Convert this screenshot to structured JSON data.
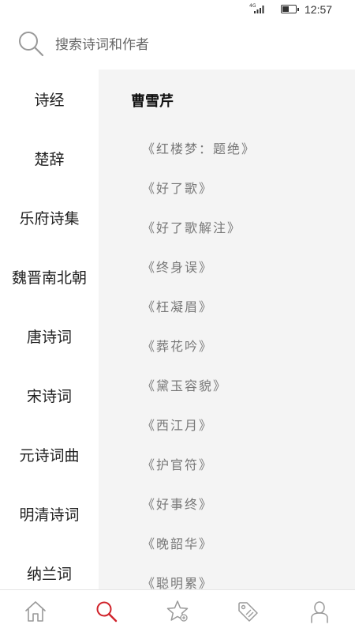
{
  "status_bar": {
    "network": "4G",
    "time": "12:57",
    "battery_level": 0.55,
    "icons": [
      "signal-icon",
      "battery-icon"
    ]
  },
  "search": {
    "placeholder": "搜索诗词和作者",
    "value": "",
    "icon": "search-icon"
  },
  "sidebar": {
    "items": [
      {
        "label": "诗经"
      },
      {
        "label": "楚辞"
      },
      {
        "label": "乐府诗集"
      },
      {
        "label": "魏晋南北朝"
      },
      {
        "label": "唐诗词"
      },
      {
        "label": "宋诗词"
      },
      {
        "label": "元诗词曲"
      },
      {
        "label": "明清诗词"
      },
      {
        "label": "纳兰词"
      }
    ]
  },
  "content": {
    "author": "曹雪芹",
    "poems": [
      {
        "title": "《红楼梦：题绝》"
      },
      {
        "title": "《好了歌》"
      },
      {
        "title": "《好了歌解注》"
      },
      {
        "title": "《终身误》"
      },
      {
        "title": "《枉凝眉》"
      },
      {
        "title": "《葬花吟》"
      },
      {
        "title": "《黛玉容貌》"
      },
      {
        "title": "《西江月》"
      },
      {
        "title": "《护官符》"
      },
      {
        "title": "《好事终》"
      },
      {
        "title": "《晚韶华》"
      },
      {
        "title": "《聪明累》"
      }
    ]
  },
  "bottom_nav": {
    "items": [
      {
        "icon": "home-icon",
        "active": false
      },
      {
        "icon": "search-icon",
        "active": true
      },
      {
        "icon": "star-icon",
        "active": false
      },
      {
        "icon": "tag-icon",
        "active": false
      },
      {
        "icon": "user-icon",
        "active": false
      }
    ],
    "active_color": "#d0222a",
    "inactive_color": "#999999"
  },
  "colors": {
    "content_background": "#f4f4f4",
    "poem_text": "#777777",
    "accent": "#d0222a"
  }
}
